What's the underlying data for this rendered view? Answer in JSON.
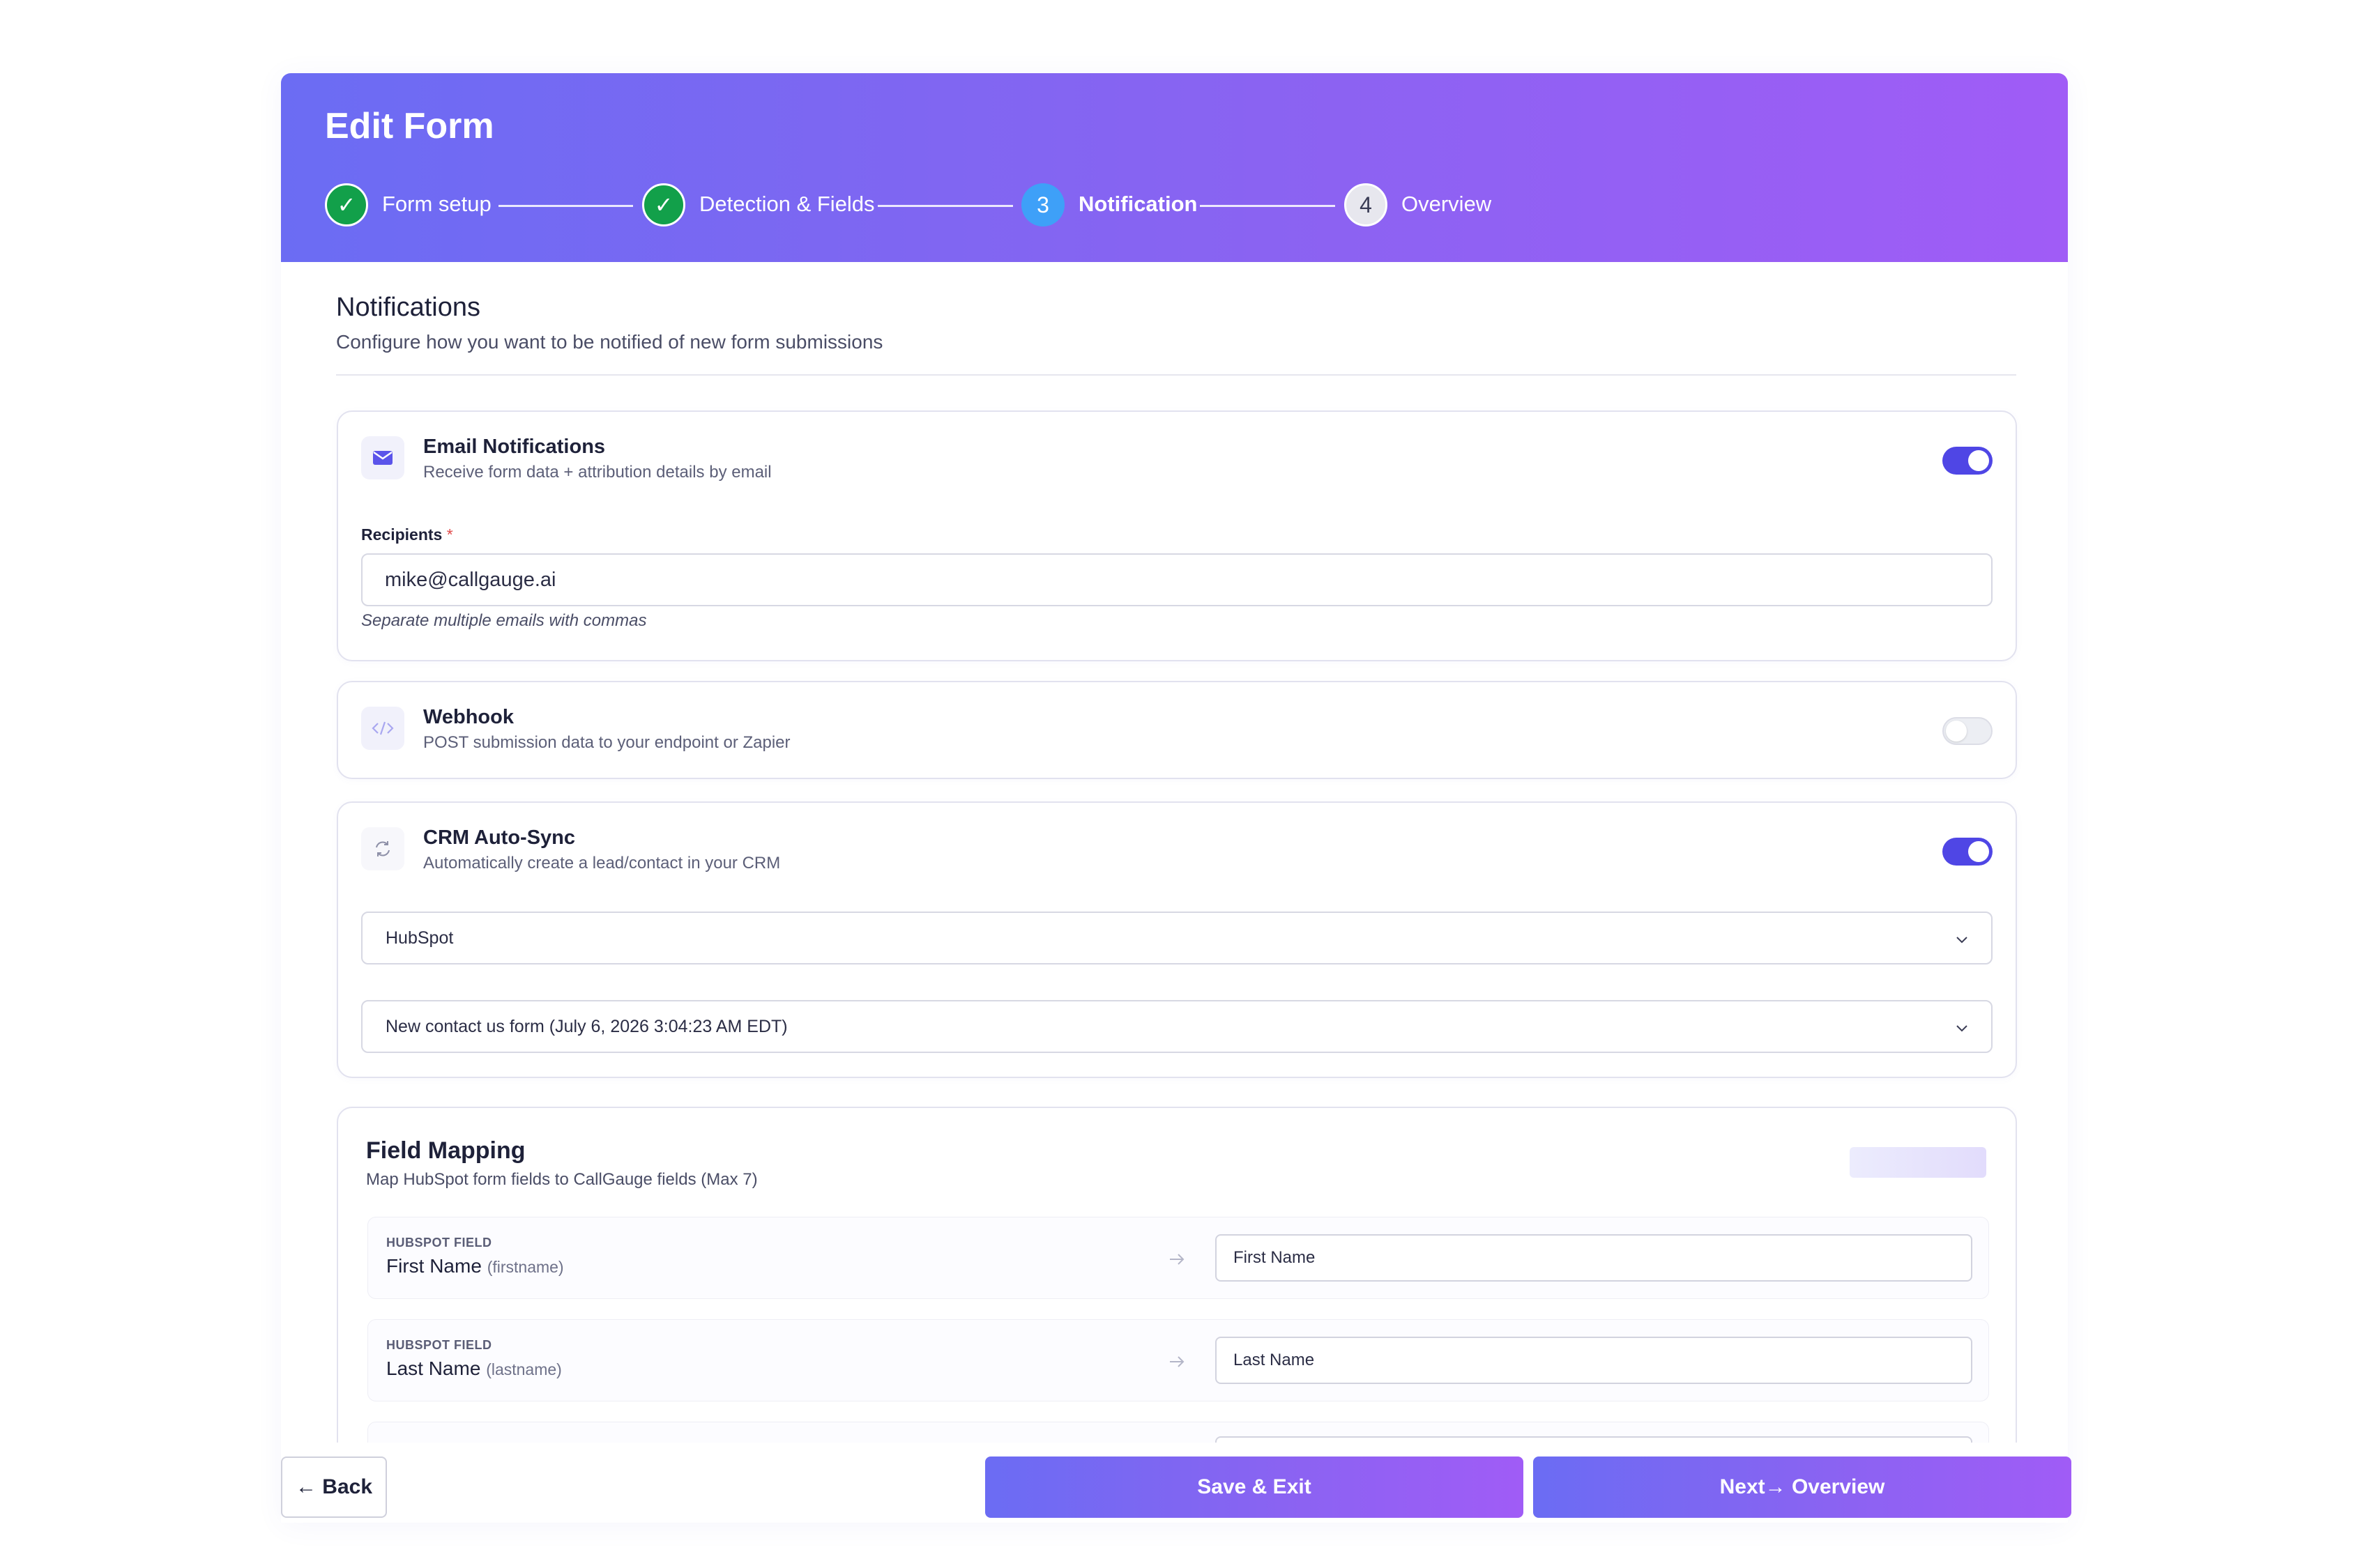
{
  "header": {
    "title": "Edit Form",
    "steps": [
      {
        "number": "1",
        "label": "Form setup",
        "state": "done"
      },
      {
        "number": "2",
        "label": "Detection & Fields",
        "state": "done"
      },
      {
        "number": "3",
        "label": "Notification",
        "state": "current"
      },
      {
        "number": "4",
        "label": "Overview",
        "state": "future"
      }
    ],
    "check_glyph": "✓"
  },
  "section": {
    "title": "Notifications",
    "subtitle": "Configure how you want to be notified of new form submissions"
  },
  "email": {
    "icon": "mail-icon",
    "title": "Email Notifications",
    "subtitle": "Receive form data + attribution details by email",
    "enabled": true,
    "recipients_label": "Recipients",
    "required_mark": "*",
    "recipients_value": "mike@callgauge.ai",
    "hint": "Separate multiple emails with commas"
  },
  "webhook": {
    "icon": "code-icon",
    "title": "Webhook",
    "subtitle": "POST submission data to your endpoint or Zapier",
    "enabled": false
  },
  "crm": {
    "icon": "sync-icon",
    "title": "CRM Auto-Sync",
    "subtitle": "Automatically create a lead/contact in your CRM",
    "enabled": true,
    "provider_selected": "HubSpot",
    "form_selected": "New contact us form (July 6, 2026 3:04:23 AM EDT)"
  },
  "field_mapping": {
    "title": "Field Mapping",
    "subtitle": "Map HubSpot form fields to CallGauge fields (Max 7)",
    "rows": [
      {
        "kicker": "HUBSPOT FIELD",
        "name": "First Name",
        "key": "(firstname)",
        "mapped": "First Name"
      },
      {
        "kicker": "HUBSPOT FIELD",
        "name": "Last Name",
        "key": "(lastname)",
        "mapped": "Last Name"
      }
    ]
  },
  "footer": {
    "back_label": "← Back",
    "save_label": "Save & Exit",
    "next_label": "Next→ Overview"
  },
  "colors": {
    "accent": "#4f46e5",
    "gradient_start": "#6b6cf3",
    "gradient_end": "#a05cf6",
    "success": "#12a04a",
    "current_step": "#3ea0f8"
  }
}
